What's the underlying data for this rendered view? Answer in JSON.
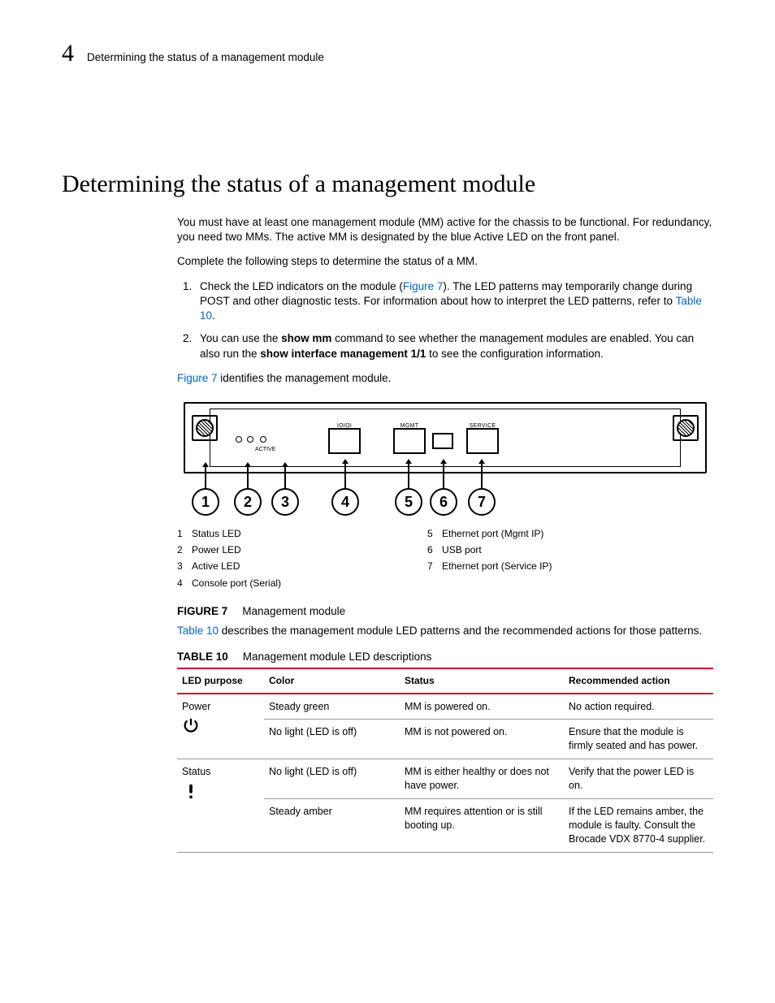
{
  "header": {
    "chapter_number": "4",
    "chapter_title": "Determining the status of a management module"
  },
  "heading": "Determining the status of a management module",
  "intro_p1": "You must have at least one management module (MM) active for the chassis to be functional. For redundancy, you need two MMs. The active MM is designated by the blue Active LED on the front panel.",
  "intro_p2": "Complete the following steps to determine the status of a MM.",
  "steps": {
    "s1a": "Check the LED indicators on the module (",
    "s1_ref": "Figure 7",
    "s1b": "). The LED patterns may temporarily change during POST and other diagnostic tests. For information about how to interpret the LED patterns, refer to ",
    "s1_ref2": "Table 10",
    "s1c": ".",
    "s2a": "You can use the ",
    "s2_cmd1": "show mm",
    "s2b": " command to see whether the management modules are enabled. You can also run the ",
    "s2_cmd2": "show interface management 1/1",
    "s2c": " to see the configuration information."
  },
  "fig_intro_ref": "Figure 7",
  "fig_intro_rest": " identifies the management module.",
  "module_labels": {
    "ioioi": "IOIOI",
    "mgmt": "MGMT",
    "service": "SERVICE",
    "active": "ACTIVE"
  },
  "callout_numbers": [
    "1",
    "2",
    "3",
    "4",
    "5",
    "6",
    "7"
  ],
  "legend_left": [
    {
      "n": "1",
      "t": "Status LED"
    },
    {
      "n": "2",
      "t": "Power LED"
    },
    {
      "n": "3",
      "t": "Active LED"
    },
    {
      "n": "4",
      "t": "Console port (Serial)"
    }
  ],
  "legend_right": [
    {
      "n": "5",
      "t": "Ethernet port (Mgmt IP)"
    },
    {
      "n": "6",
      "t": "USB port"
    },
    {
      "n": "7",
      "t": "Ethernet port (Service IP)"
    }
  ],
  "fig_caption": {
    "label": "FIGURE 7",
    "text": "Management module"
  },
  "table_intro_ref": "Table 10",
  "table_intro_rest": " describes the management module LED patterns and the recommended actions for those patterns.",
  "tbl_caption": {
    "label": "TABLE 10",
    "text": "Management module LED descriptions"
  },
  "table": {
    "headers": [
      "LED purpose",
      "Color",
      "Status",
      "Recommended action"
    ],
    "rows": [
      {
        "purpose": "Power",
        "icon": "power",
        "color": "Steady green",
        "status": "MM is powered on.",
        "action": "No action required."
      },
      {
        "purpose": "",
        "icon": "",
        "color": "No light (LED is off)",
        "status": "MM is not powered on.",
        "action": "Ensure that the module is firmly seated and has power."
      },
      {
        "purpose": "Status",
        "icon": "status",
        "color": "No light (LED is off)",
        "status": "MM is either healthy or does not have power.",
        "action": "Verify that the power LED is on."
      },
      {
        "purpose": "",
        "icon": "",
        "color": "Steady amber",
        "status": "MM requires attention or is still booting up.",
        "action": "If the LED remains amber, the module is faulty. Consult the Brocade VDX 8770-4 supplier."
      }
    ]
  }
}
